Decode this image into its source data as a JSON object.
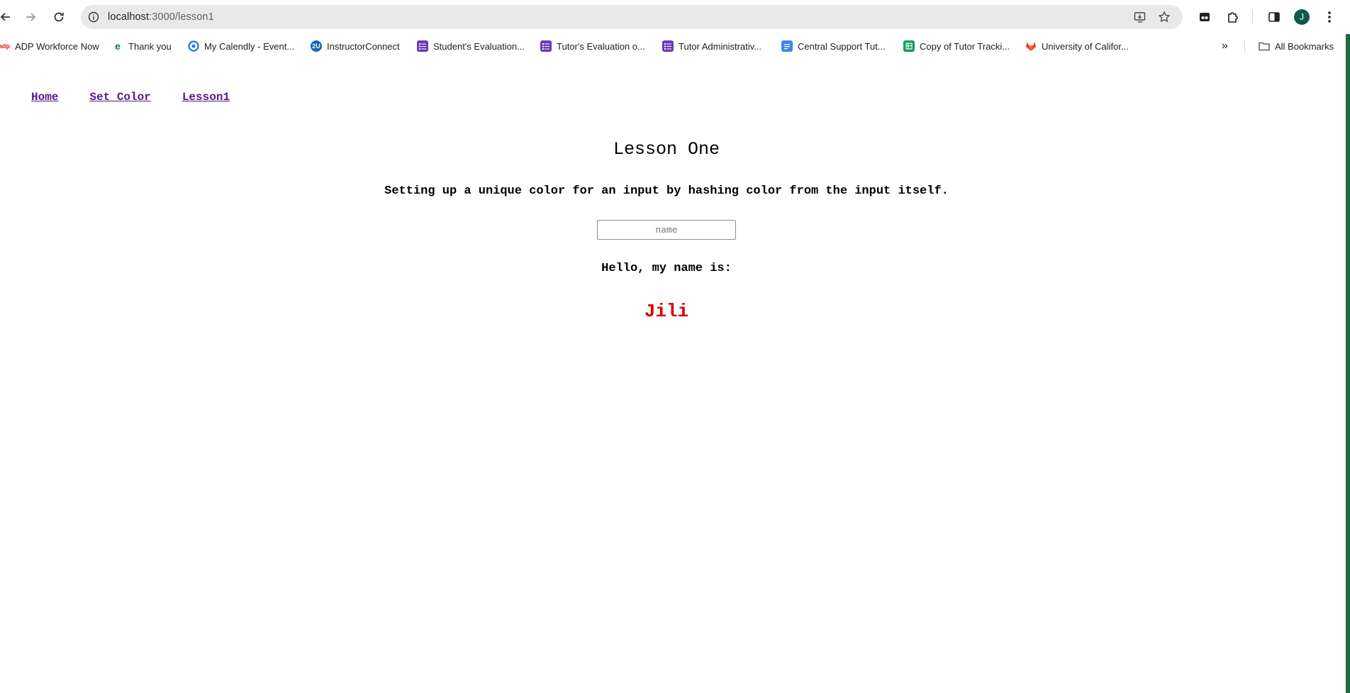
{
  "browser": {
    "url_host": "localhost",
    "url_path": ":3000/lesson1",
    "avatar_initial": "J",
    "bookmarks": [
      {
        "label": "ADP Workforce Now",
        "icon": "adp-icon",
        "color": "#d0271d"
      },
      {
        "label": "Thank you",
        "icon": "e-icon",
        "color": "#0f7b3c"
      },
      {
        "label": "My Calendly - Event...",
        "icon": "calendly-icon",
        "color": "#1a73e8"
      },
      {
        "label": "InstructorConnect",
        "icon": "2u-icon",
        "color": "#1565c0"
      },
      {
        "label": "Student's Evaluation...",
        "icon": "forms-icon",
        "color": "#673ab7"
      },
      {
        "label": "Tutor's Evaluation o...",
        "icon": "forms-icon",
        "color": "#673ab7"
      },
      {
        "label": "Tutor Administrativ...",
        "icon": "forms-icon",
        "color": "#673ab7"
      },
      {
        "label": "Central Support Tut...",
        "icon": "docs-icon",
        "color": "#4285f4"
      },
      {
        "label": "Copy of Tutor Tracki...",
        "icon": "sheets-icon",
        "color": "#0f9d58"
      },
      {
        "label": "University of Califor...",
        "icon": "gitlab-icon",
        "color": "#e24329"
      }
    ],
    "all_bookmarks_label": "All Bookmarks"
  },
  "page": {
    "nav": {
      "home": "Home",
      "set_color": "Set Color",
      "lesson1": "Lesson1"
    },
    "title": "Lesson One",
    "subtitle": "Setting up a unique color for an input by hashing color from the input itself.",
    "name_input": {
      "placeholder": "name",
      "value": ""
    },
    "hello_label": "Hello, my name is:",
    "name_output": "Jili",
    "name_color": "#d40000"
  }
}
